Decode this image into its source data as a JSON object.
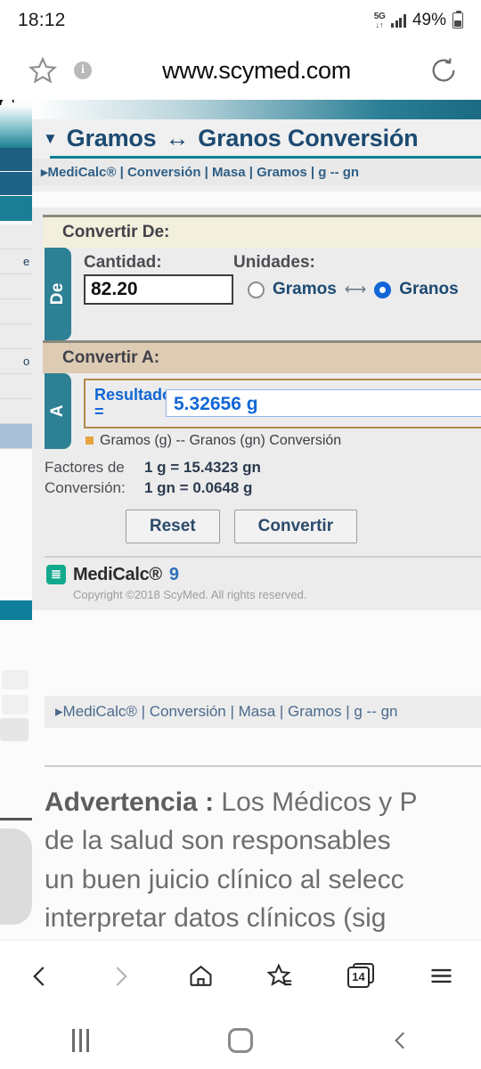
{
  "status_bar": {
    "time": "18:12",
    "network_label": "5G",
    "network_arrows": "↓↑",
    "battery_percent": "49%",
    "signal_icon": "signal-bars-icon",
    "battery_icon": "battery-icon"
  },
  "browser": {
    "url": "www.scymed.com",
    "star_icon": "star-icon",
    "info_icon": "info-icon",
    "reload_icon": "reload-icon",
    "bottom": {
      "back": "back-arrow-icon",
      "forward": "forward-arrow-icon",
      "home": "home-icon",
      "bookmarks": "bookmarks-star-icon",
      "tabs_count": "14",
      "menu": "hamburger-menu-icon"
    }
  },
  "android_nav": {
    "recents_icon": "recents-icon",
    "home_icon": "home-circle-icon",
    "back_icon": "back-chevron-icon"
  },
  "sidebar_strip": {
    "logo_fragment": "C",
    "items": [
      "",
      "e",
      "",
      "",
      "",
      "o",
      "",
      "",
      ""
    ],
    "selected_index": 8
  },
  "page": {
    "title": {
      "caret": "▼",
      "from_unit": "Gramos",
      "swap": "↔",
      "to_unit": "Granos Conversión"
    },
    "breadcrumb": {
      "arrow": "▸",
      "parts": [
        "MediCalc®",
        "Conversión",
        "Masa",
        "Gramos",
        "g -- gn"
      ],
      "text": "▸MediCalc® | Conversión | Masa | Gramos | g -- gn"
    },
    "convert_from": {
      "band_label": "Convertir De:",
      "tab_label": "De",
      "amount_label": "Cantidad:",
      "units_label": "Unidades:",
      "amount_value": "82.20",
      "amount_placeholder": "",
      "unit_option_1": "Gramos",
      "unit_option_2": "Granos",
      "swap_arrow": "⟷",
      "selected_unit": "Granos"
    },
    "convert_to": {
      "band_label": "Convertir A:",
      "tab_label": "A",
      "result_label": "Resultado =",
      "result_value": "5.32656 g",
      "sub_link": "Gramos (g) -- Granos (gn) Conversión"
    },
    "factors": {
      "label_line1": "Factores de",
      "label_line2": "Conversión:",
      "value_line1": "1 g = 15.4323 gn",
      "value_line2": "1 gn = 0.0648 g"
    },
    "buttons": {
      "reset": "Reset",
      "convert": "Convertir"
    },
    "footer": {
      "product": "MediCalc®",
      "version": "9",
      "icon": "medicalc-logo-icon",
      "copyright": "Copyright ©2018 ScyMed.  All rights reserved."
    },
    "breadcrumb_bottom": "▸MediCalc® | Conversión | Masa | Gramos | g -- gn",
    "warning": {
      "heading": "Advertencia :",
      "line1_rest": " Los Médicos y P",
      "line2": "de la salud son responsables",
      "line3": "un buen juicio clínico al selecc",
      "line4": "interpretar datos clínicos (sig"
    }
  },
  "colors": {
    "teal": "#2e8094",
    "title_blue": "#1c4a72",
    "result_blue": "#1267d8",
    "band_de": "#f2f0dc",
    "band_a": "#ddccb3",
    "accent_orange": "#e8a33d"
  }
}
